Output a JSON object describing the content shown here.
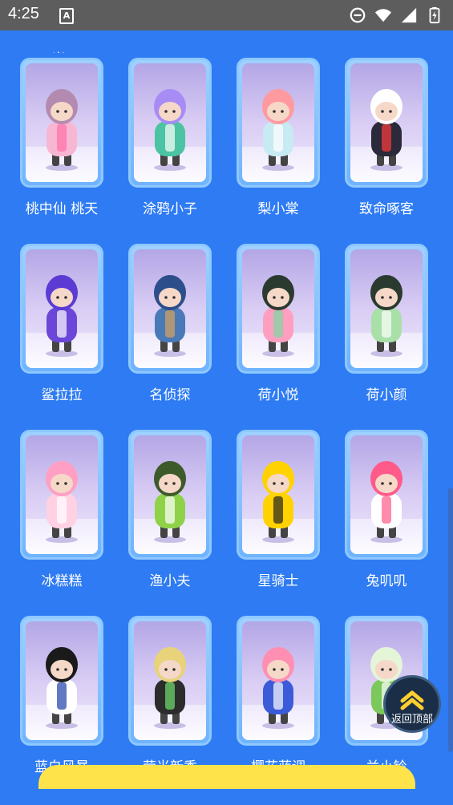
{
  "status_bar": {
    "time": "4:25",
    "app_icon": "A"
  },
  "clipped_text": "光",
  "skins": [
    {
      "name": "桃中仙 桃天",
      "hair": "#b48bb0",
      "body": "#f7b6d2",
      "accent": "#ff6fa8"
    },
    {
      "name": "涂鸦小子",
      "hair": "#a88cf5",
      "body": "#4cc3a2",
      "accent": "#ffffff"
    },
    {
      "name": "梨小棠",
      "hair": "#ff9aa0",
      "body": "#c8eaf2",
      "accent": "#ffffff"
    },
    {
      "name": "致命啄客",
      "hair": "#ffffff",
      "body": "#2a2a3a",
      "accent": "#ff3b3b"
    },
    {
      "name": "鲨拉拉",
      "hair": "#5b3bd4",
      "body": "#6b46d8",
      "accent": "#ffffff"
    },
    {
      "name": "名侦探",
      "hair": "#2c4e8a",
      "body": "#4a79b8",
      "accent": "#d9a35a"
    },
    {
      "name": "荷小悦",
      "hair": "#2b3a2f",
      "body": "#ff9fbf",
      "accent": "#7bd9a0"
    },
    {
      "name": "荷小颜",
      "hair": "#2b3a2f",
      "body": "#a8e0a8",
      "accent": "#ffffff"
    },
    {
      "name": "冰糕糕",
      "hair": "#ff9fc3",
      "body": "#ffd1e3",
      "accent": "#ffffff"
    },
    {
      "name": "渔小夫",
      "hair": "#3d5a2a",
      "body": "#8fd24a",
      "accent": "#ffffff"
    },
    {
      "name": "星骑士",
      "hair": "#ffd200",
      "body": "#ffd200",
      "accent": "#222222"
    },
    {
      "name": "兔叽叽",
      "hair": "#ff5a8a",
      "body": "#ffffff",
      "accent": "#ff5a8a"
    },
    {
      "name": "蓝白风暴",
      "hair": "#1a1a1a",
      "body": "#ffffff",
      "accent": "#1e3fa8"
    },
    {
      "name": "荧光新秀",
      "hair": "#e8d27a",
      "body": "#2c2c2c",
      "accent": "#6fe06f"
    },
    {
      "name": "樱花蓝调",
      "hair": "#ff8fb2",
      "body": "#3b5bd8",
      "accent": "#ffffff"
    },
    {
      "name": "兰小铃",
      "hair": "#e5f5d8",
      "body": "#7bc95a",
      "accent": "#ffffff"
    }
  ],
  "back_to_top": {
    "label": "返回顶部"
  }
}
